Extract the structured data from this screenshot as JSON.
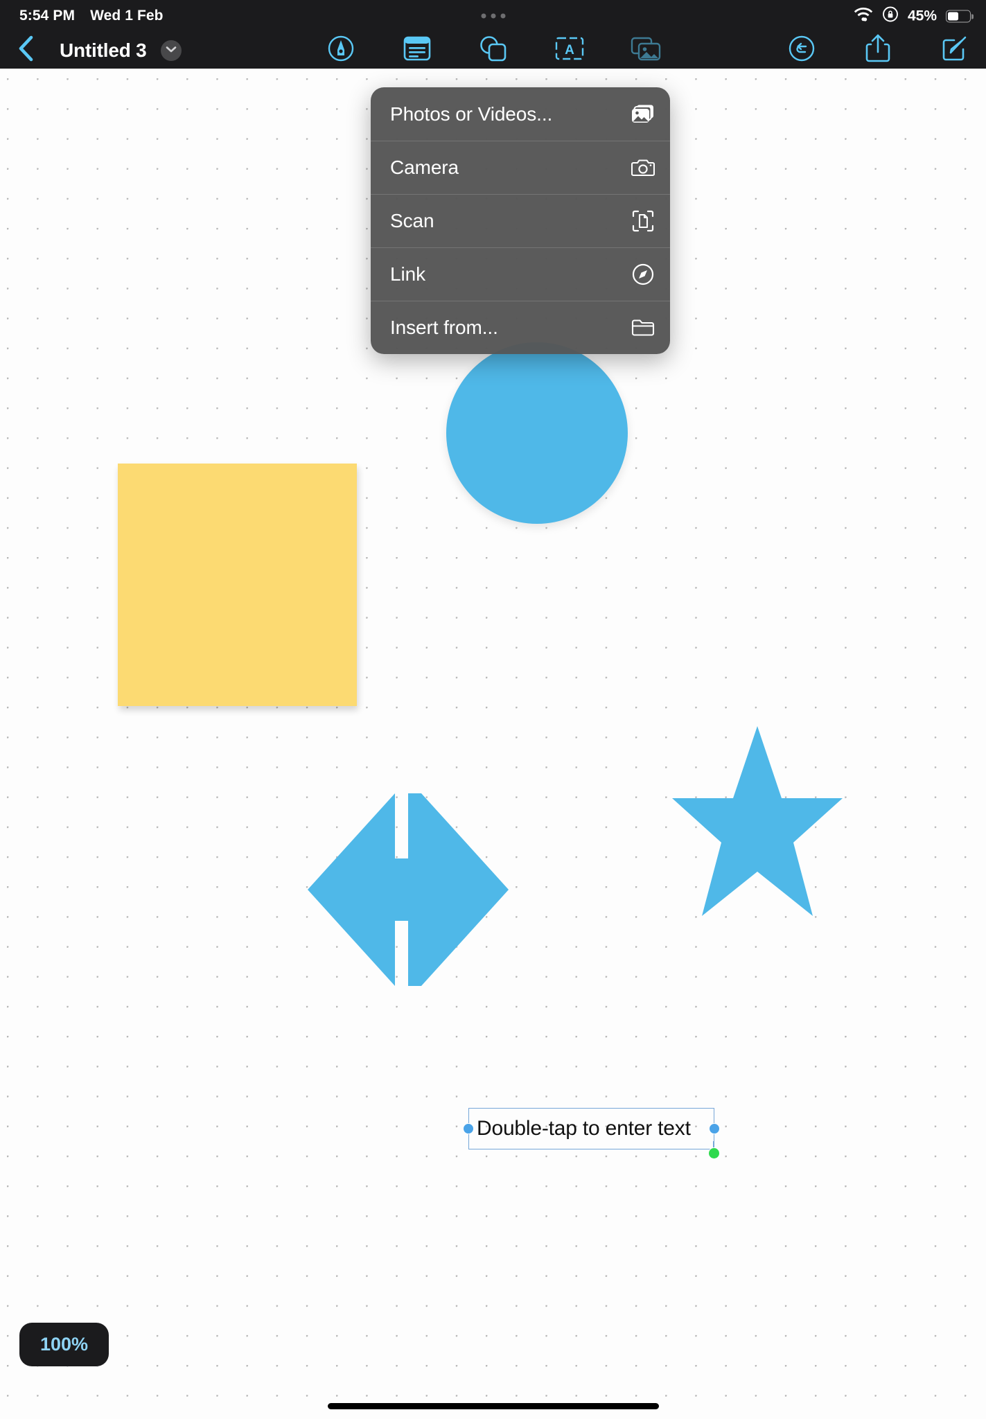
{
  "statusbar": {
    "time": "5:54 PM",
    "date": "Wed 1 Feb",
    "battery_percent": "45%",
    "wifi_icon": "wifi-icon",
    "rotation_lock_icon": "rotation-lock-icon",
    "battery_icon": "battery-icon",
    "multitask_icon": "multitasking-dots-icon"
  },
  "toolbar": {
    "back_icon": "back-chevron-icon",
    "title": "Untitled 3",
    "title_menu_icon": "chevron-down-icon",
    "tools": [
      {
        "name": "markup-pen-tool",
        "icon": "pen-in-circle-icon",
        "active": false
      },
      {
        "name": "sticky-note-tool",
        "icon": "sticky-note-icon",
        "active": false
      },
      {
        "name": "shapes-tool",
        "icon": "shapes-icon",
        "active": false
      },
      {
        "name": "text-box-tool",
        "icon": "text-box-a-icon",
        "active": false
      },
      {
        "name": "media-tool",
        "icon": "media-photos-icon",
        "active": true
      }
    ],
    "actions": [
      {
        "name": "undo-button",
        "icon": "undo-circle-icon"
      },
      {
        "name": "share-button",
        "icon": "share-up-arrow-icon"
      },
      {
        "name": "compose-button",
        "icon": "compose-pencil-icon"
      }
    ]
  },
  "menu": {
    "items": [
      {
        "label": "Photos or Videos...",
        "icon": "photos-stack-icon"
      },
      {
        "label": "Camera",
        "icon": "camera-icon"
      },
      {
        "label": "Scan",
        "icon": "scan-document-icon"
      },
      {
        "label": "Link",
        "icon": "safari-compass-icon"
      },
      {
        "label": "Insert from...",
        "icon": "folder-icon"
      }
    ]
  },
  "canvas": {
    "zoom_level": "100%",
    "objects": [
      {
        "name": "sticky-note",
        "type": "square",
        "color": "#fcda72"
      },
      {
        "name": "circle-shape",
        "type": "circle",
        "color": "#4fb8e8"
      },
      {
        "name": "double-arrow-shape",
        "type": "left-right-arrow",
        "color": "#4fb8e8"
      },
      {
        "name": "star-shape",
        "type": "star",
        "color": "#4fb8e8"
      },
      {
        "name": "text-box",
        "type": "text",
        "text": "Double-tap to enter text",
        "selected": true
      }
    ],
    "text_box": {
      "text": "Double-tap to enter text",
      "handle_color": "#4aa3e8",
      "rotate_handle_color": "#2fd94e",
      "frame_color": "#76a7d8"
    }
  },
  "colors": {
    "accent_blue": "#5ac8f5",
    "shape_blue": "#4fb8e8",
    "sticky_yellow": "#fcda72",
    "chrome_dark": "#1b1b1d",
    "menu_gray": "#565656"
  }
}
